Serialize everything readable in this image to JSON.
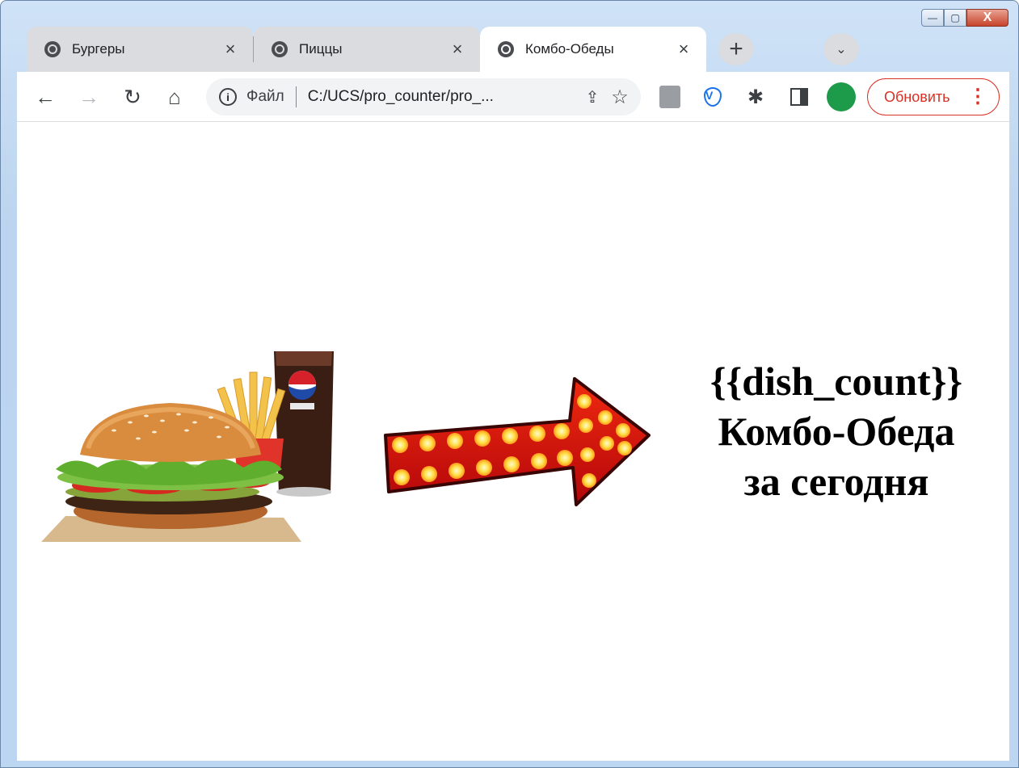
{
  "window": {
    "controls": {
      "minimize": "—",
      "maximize": "▢",
      "close": "X"
    }
  },
  "tabs": [
    {
      "label": "Бургеры",
      "close": "×",
      "active": false
    },
    {
      "label": "Пиццы",
      "close": "×",
      "active": false
    },
    {
      "label": "Комбо-Обеды",
      "close": "×",
      "active": true
    }
  ],
  "tabstrip": {
    "new_tab": "+",
    "tab_search": "⌄"
  },
  "toolbar": {
    "back": "←",
    "forward": "→",
    "reload": "↻",
    "home": "⌂",
    "omnibox": {
      "info_icon": "i",
      "scheme_label": "Файл",
      "url": "C:/UCS/pro_counter/pro_...",
      "share_icon": "⇪",
      "bookmark_icon": "☆"
    },
    "update_label": "Обновить",
    "menu_icon": "⋮"
  },
  "content": {
    "line1": "{{dish_count}}",
    "line2": "Комбо-Обеда",
    "line3": "за сегодня"
  },
  "colors": {
    "accent_update": "#d93025",
    "tab_inactive": "#dadce0",
    "arrow_red": "#d40a0a",
    "bulb_yellow": "#ffe04a"
  }
}
